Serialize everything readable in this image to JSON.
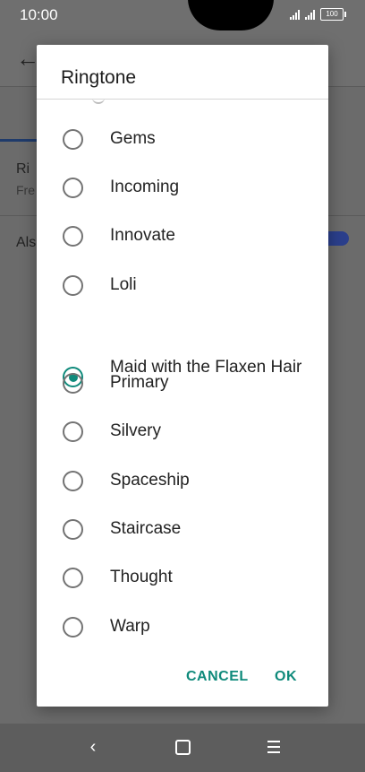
{
  "status_bar": {
    "time": "10:00",
    "battery": "100"
  },
  "background": {
    "row1_title": "Ri",
    "row1_sub": "Fre",
    "row2_title": "Als"
  },
  "dialog": {
    "title": "Ringtone",
    "options": [
      {
        "label": "Gems",
        "selected": false
      },
      {
        "label": "Incoming",
        "selected": false
      },
      {
        "label": "Innovate",
        "selected": false
      },
      {
        "label": "Loli",
        "selected": false
      },
      {
        "label": "Maid with the Flaxen Hair",
        "selected": true
      },
      {
        "label": "Primary",
        "selected": false
      },
      {
        "label": "Silvery",
        "selected": false
      },
      {
        "label": "Spaceship",
        "selected": false
      },
      {
        "label": "Staircase",
        "selected": false
      },
      {
        "label": "Thought",
        "selected": false
      },
      {
        "label": "Warp",
        "selected": false
      }
    ],
    "cancel_label": "CANCEL",
    "ok_label": "OK"
  },
  "nav": {
    "back_icon": "chevron-left-icon",
    "home_icon": "home-square-icon",
    "menu_icon": "menu-lines-icon"
  },
  "colors": {
    "accent": "#0f8a7b",
    "scrim": "#6b6b6b"
  }
}
